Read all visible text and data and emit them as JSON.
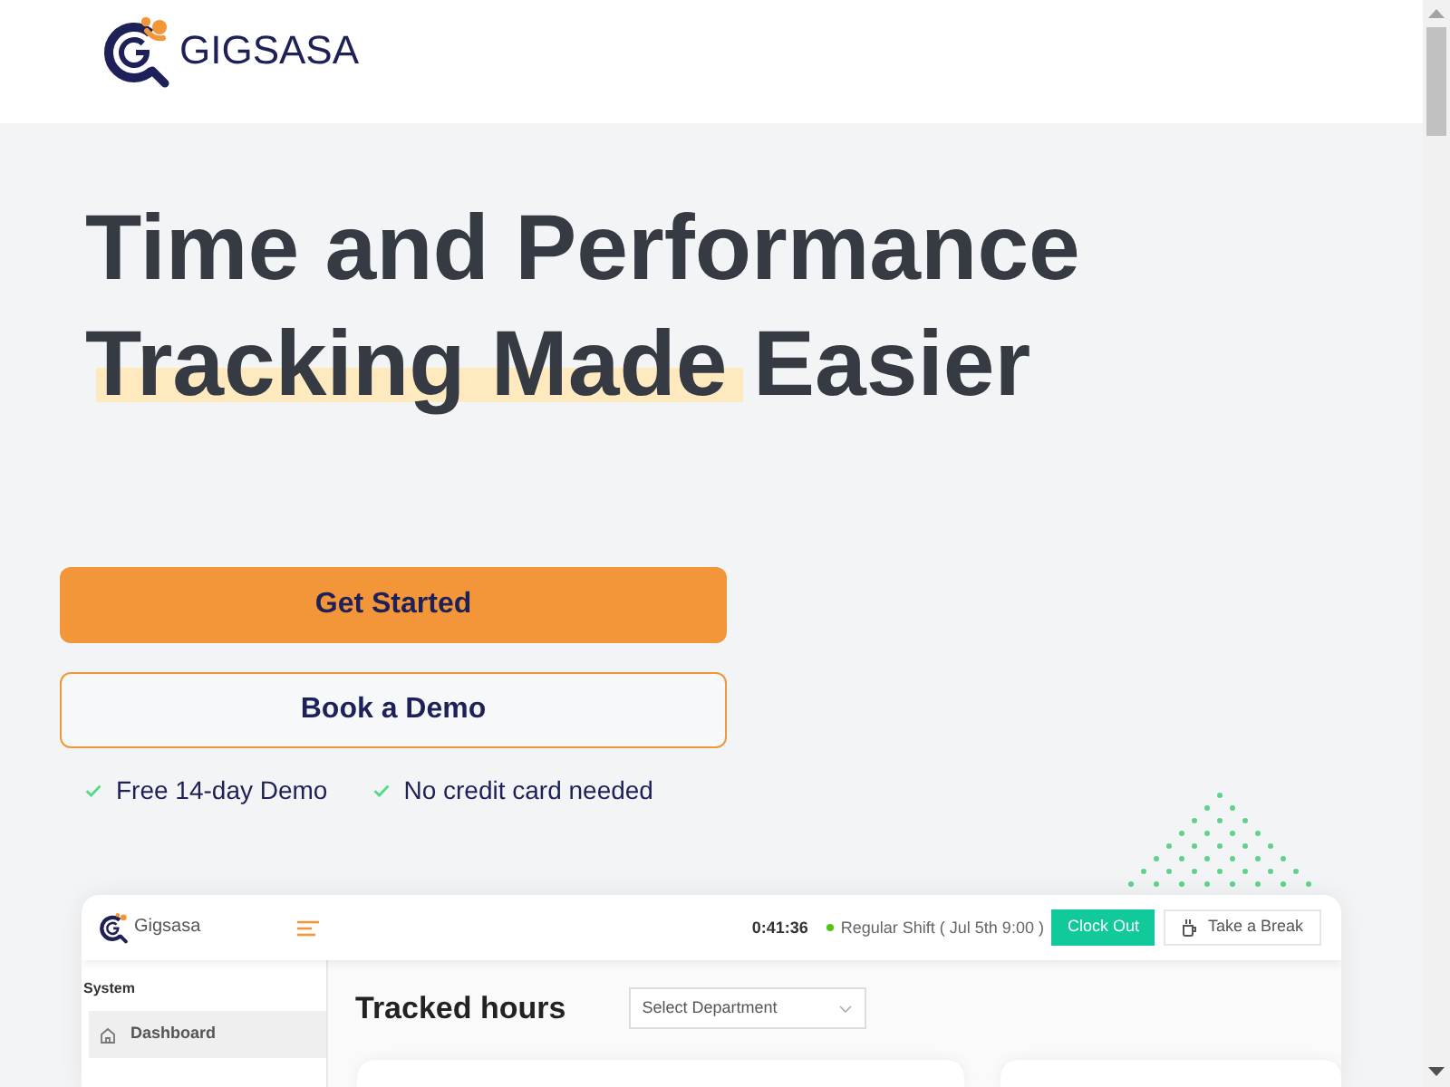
{
  "header": {
    "brand": "GIGSASA"
  },
  "hero": {
    "headline": [
      [
        {
          "text": "Time and Performance",
          "highlighted": false
        }
      ],
      [
        {
          "text": "Tracking Made",
          "highlighted": true
        },
        {
          "text": "Easier",
          "highlighted": false
        }
      ]
    ],
    "buttons": [
      {
        "label": "Get Started",
        "kind": "primary"
      },
      {
        "label": "Book a Demo",
        "kind": "outline"
      }
    ],
    "perks": [
      "Free 14-day Demo",
      "No credit card needed"
    ]
  },
  "app_preview": {
    "brand": "Gigsasa",
    "timer": "0:41:36",
    "shift": "Regular Shift ( Jul 5th 9:00 )",
    "actions": [
      {
        "label": "Clock Out",
        "kind": "primary"
      },
      {
        "label": "Take a Break",
        "kind": "secondary"
      }
    ],
    "sidebar": {
      "section": "System",
      "items": [
        {
          "label": "Dashboard",
          "selected": true
        }
      ]
    },
    "title": "Tracked hours",
    "department_select": {
      "placeholder": "Select Department"
    }
  }
}
